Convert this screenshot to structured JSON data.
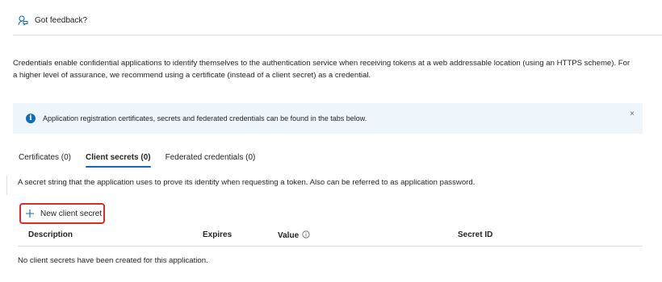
{
  "feedback": {
    "label": "Got feedback?"
  },
  "intro": {
    "text": "Credentials enable confidential applications to identify themselves to the authentication service when receiving tokens at a web addressable location (using an HTTPS scheme). For a higher level of assurance, we recommend using a certificate (instead of a client secret) as a credential."
  },
  "banner": {
    "text": "Application registration certificates, secrets and federated credentials can be found in the tabs below.",
    "close": "×"
  },
  "tabs": [
    {
      "label": "Certificates (0)"
    },
    {
      "label": "Client secrets (0)"
    },
    {
      "label": "Federated credentials (0)"
    }
  ],
  "client_secrets": {
    "description": "A secret string that the application uses to prove its identity when requesting a token. Also can be referred to as application password.",
    "new_button": "New client secret",
    "columns": [
      "Description",
      "Expires",
      "Value",
      "Secret ID"
    ],
    "empty_message": "No client secrets have been created for this application."
  },
  "colors": {
    "accent": "#0f6cbd",
    "highlight_border": "#d92c2c",
    "banner_bg": "#eef6fc"
  }
}
